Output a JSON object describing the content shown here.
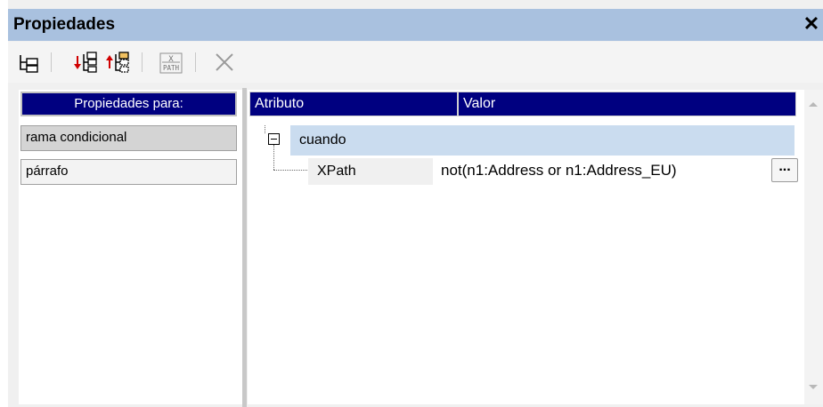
{
  "window": {
    "title": "Propiedades",
    "close_glyph": "✕"
  },
  "toolbar": {
    "buttons": [
      {
        "name": "tree-structure-icon"
      },
      {
        "name": "insert-before-icon"
      },
      {
        "name": "insert-child-icon"
      },
      {
        "name": "xpath-icon",
        "label_top": "X",
        "label_bottom": "PATH"
      },
      {
        "name": "delete-icon"
      }
    ]
  },
  "left_pane": {
    "header": "Propiedades para:",
    "items": [
      {
        "label": "rama condicional",
        "selected": true
      },
      {
        "label": "párrafo",
        "selected": false
      }
    ]
  },
  "right_pane": {
    "columns": [
      "Atributo",
      "Valor"
    ],
    "tree": {
      "group_label": "cuando",
      "attribute": "XPath",
      "value": "not(n1:Address or  n1:Address_EU)",
      "edit_button": "..."
    }
  },
  "colors": {
    "title_bar": "#a9c1df",
    "header_bg": "#000080",
    "selected_row": "#cadcef",
    "delete_icon": "#9a9a9a"
  }
}
